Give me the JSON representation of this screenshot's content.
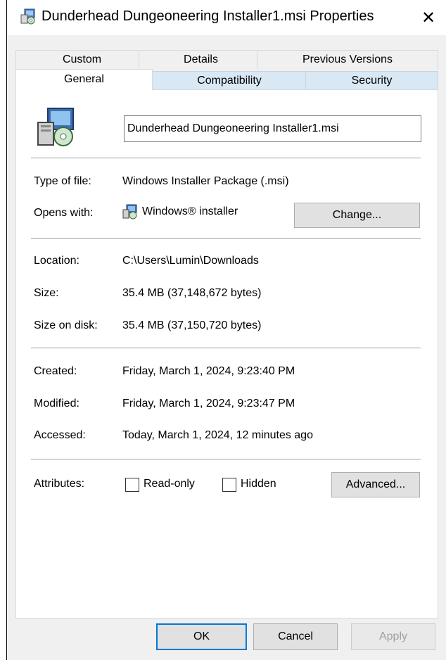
{
  "window": {
    "title": "Dunderhead Dungeoneering Installer1.msi Properties",
    "close_glyph": "✕"
  },
  "tabs": {
    "row1": [
      "Custom",
      "Details",
      "Previous Versions"
    ],
    "row2": [
      "General",
      "Compatibility",
      "Security"
    ],
    "active": "General"
  },
  "general": {
    "file_name": "Dunderhead Dungeoneering Installer1.msi",
    "type_label": "Type of file:",
    "type_value": "Windows Installer Package (.msi)",
    "opens_label": "Opens with:",
    "opens_value": "Windows® installer",
    "change_button": "Change...",
    "location_label": "Location:",
    "location_value": "C:\\Users\\Lumin\\Downloads",
    "size_label": "Size:",
    "size_value": "35.4 MB (37,148,672 bytes)",
    "size_on_disk_label": "Size on disk:",
    "size_on_disk_value": "35.4 MB (37,150,720 bytes)",
    "created_label": "Created:",
    "created_value": "Friday, March 1, 2024, 9:23:40 PM",
    "modified_label": "Modified:",
    "modified_value": "Friday, March 1, 2024, 9:23:47 PM",
    "accessed_label": "Accessed:",
    "accessed_value": "Today, March 1, 2024, 12 minutes ago",
    "attributes_label": "Attributes:",
    "readonly_label": "Read-only",
    "readonly_checked": false,
    "hidden_label": "Hidden",
    "hidden_checked": false,
    "advanced_button": "Advanced..."
  },
  "footer": {
    "ok": "OK",
    "cancel": "Cancel",
    "apply": "Apply"
  },
  "icons": {
    "title": "msi-package-icon",
    "file": "msi-package-icon",
    "opens_with": "windows-installer-icon"
  },
  "colors": {
    "focus_border": "#0078d7",
    "tab_row2_bg": "#d9e8f5",
    "window_bg": "#f0f0f0"
  }
}
